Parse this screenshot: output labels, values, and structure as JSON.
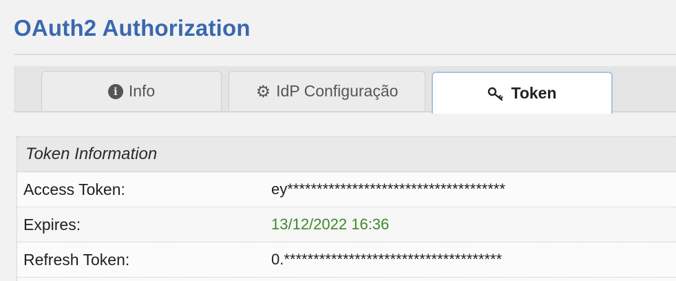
{
  "page": {
    "title": "OAuth2 Authorization"
  },
  "tabs": [
    {
      "label": "Info",
      "icon": "info-circle-icon",
      "active": false
    },
    {
      "label": "IdP Configuração",
      "icon": "gear-icon",
      "active": false
    },
    {
      "label": "Token",
      "icon": "key-icon",
      "active": true
    }
  ],
  "token_panel": {
    "header": "Token Information",
    "rows": [
      {
        "label": "Access Token:",
        "value": "ey*************************************"
      },
      {
        "label": "Expires:",
        "value": "13/12/2022 16:36"
      },
      {
        "label": "Refresh Token:",
        "value": "0.*************************************"
      }
    ]
  },
  "colors": {
    "title": "#3a68b0",
    "expires_value": "#3c8a2a",
    "active_tab_border": "#a9c2e3"
  }
}
